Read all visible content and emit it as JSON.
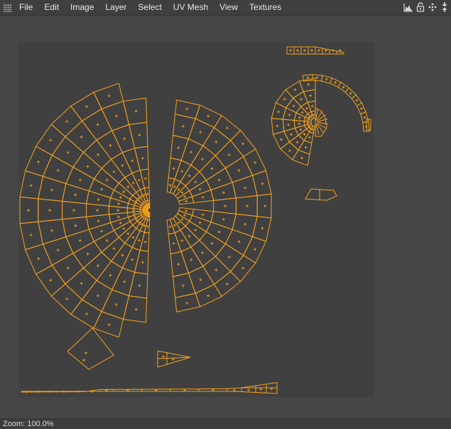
{
  "menubar": {
    "items": [
      "File",
      "Edit",
      "Image",
      "Layer",
      "Select",
      "UV Mesh",
      "View",
      "Textures"
    ]
  },
  "toolbar": {
    "icons": [
      "histogram-icon",
      "lock-icon",
      "move-icon",
      "fit-icon"
    ]
  },
  "statusbar": {
    "zoom_text": "Zoom: 100.0%"
  },
  "colors": {
    "wire": "#f5a21b",
    "canvas": "#404040",
    "background": "#464646"
  }
}
